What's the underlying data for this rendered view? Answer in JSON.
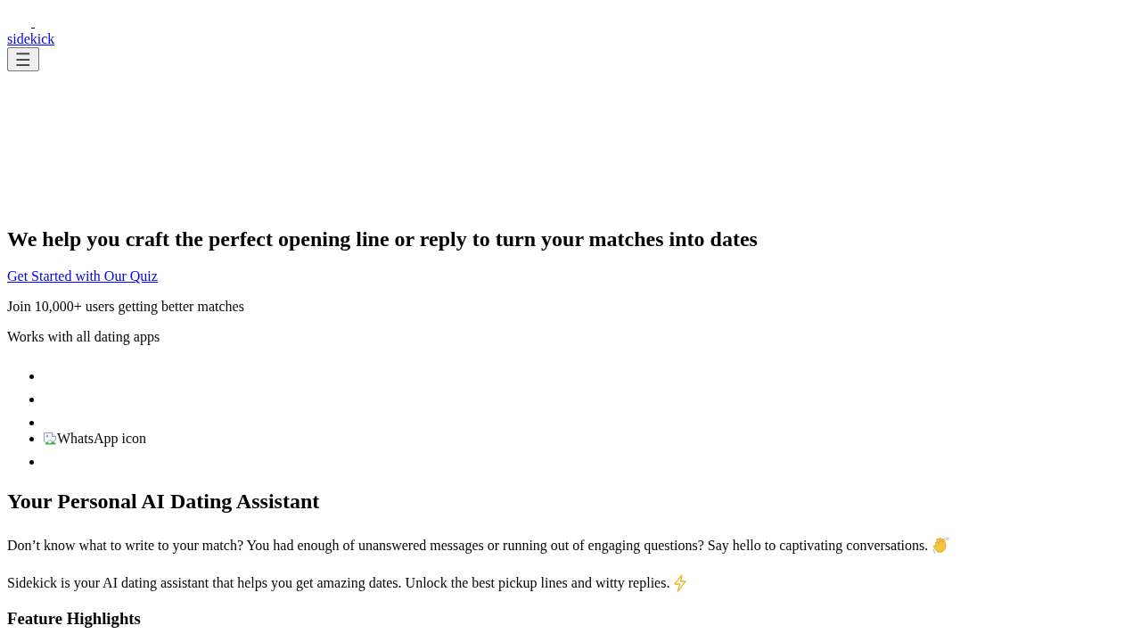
{
  "header": {
    "logo_link": "sidekick",
    "menu_button": "☰"
  },
  "hero": {
    "heading": "We help you craft the perfect opening line or reply to turn your matches into dates",
    "cta_link": "Get Started with Our Quiz",
    "users_note": "Join 10,000+ users getting better matches",
    "apps_note": "Works with all dating apps",
    "app_list": [
      {
        "kind": "blank"
      },
      {
        "kind": "blank"
      },
      {
        "kind": "blank"
      },
      {
        "kind": "broken_image",
        "alt_text": "WhatsApp icon"
      },
      {
        "kind": "blank"
      }
    ]
  },
  "intro": {
    "heading": "Your Personal AI Dating Assistant",
    "paragraphs": [
      "Don’t know what to write to your match? You had enough of unanswered messages or running out of engaging questions? Say hello to captivating conversations.",
      "Sidekick is your AI dating assistant that helps you get amazing dates. Unlock the best pickup lines and witty replies."
    ],
    "subheading": "Feature Highlights"
  }
}
